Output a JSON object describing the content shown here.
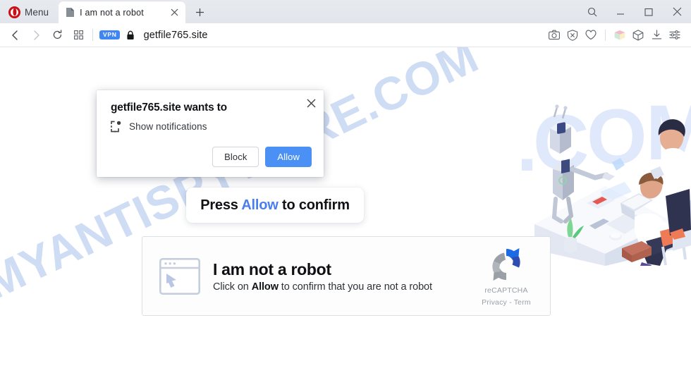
{
  "browser": {
    "name": "Opera",
    "menu_label": "Menu",
    "logo_color": "#cc0f16",
    "tabs": [
      {
        "title": "I am not a robot",
        "favicon": "page-icon",
        "active": true
      }
    ],
    "new_tab_label": "+",
    "window_controls": [
      "search-icon",
      "minimize-icon",
      "maximize-icon",
      "close-icon"
    ],
    "nav": {
      "back": "back-arrow-icon",
      "forward": "forward-arrow-icon",
      "reload": "reload-icon",
      "speeddial": "grid-icon",
      "vpn_badge": "VPN",
      "vpn_color": "#3f86f4",
      "lock": "lock-icon",
      "url": "getfile765.site"
    },
    "toolbar_icons": [
      "camera-snapshot-icon",
      "ad-blocker-shield-icon",
      "heart-icon",
      "stack-extension-icon",
      "crypto-wallet-cube-icon",
      "downloads-icon",
      "easy-setup-sliders-icon"
    ]
  },
  "dialog": {
    "title": "getfile765.site wants to",
    "permission_icon": "show-notifications-icon",
    "permission_label": "Show notifications",
    "block_label": "Block",
    "allow_label": "Allow",
    "allow_color": "#4a90f5",
    "close_label": "×"
  },
  "page": {
    "watermark": "MYANTISPYWARE.COM",
    "watermark_color": "#c2d4f2",
    "press_box": {
      "prefix": "Press ",
      "highlight": "Allow",
      "suffix": " to confirm",
      "highlight_color": "#4a7df0"
    },
    "captcha": {
      "window_icon": "browser-window-cursor-icon",
      "title": "I am not a robot",
      "subtitle_prefix": "Click on ",
      "subtitle_bold": "Allow",
      "subtitle_suffix": " to confirm that you are not a robot",
      "recaptcha_logo": "recaptcha-logo-icon",
      "recaptcha_name": "reCAPTCHA",
      "recaptcha_links": "Privacy - Term"
    },
    "illustration": "isometric-robot-office-illustration"
  }
}
